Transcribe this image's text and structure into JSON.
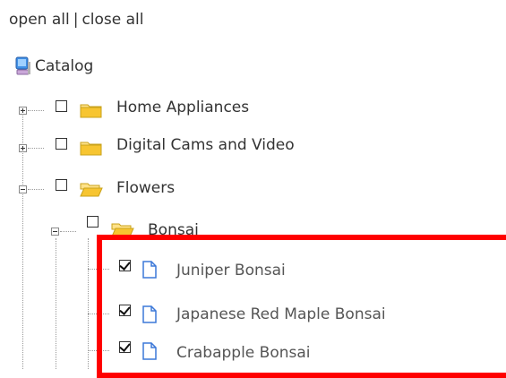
{
  "controls": {
    "open_all": "open all",
    "separator": "|",
    "close_all": "close all"
  },
  "tree": {
    "root": "Catalog",
    "items": [
      {
        "label": "Home Appliances"
      },
      {
        "label": "Digital Cams and Video"
      },
      {
        "label": "Flowers"
      },
      {
        "label": "Bonsai"
      },
      {
        "label": "Juniper Bonsai",
        "checked": true
      },
      {
        "label": "Japanese Red Maple Bonsai",
        "checked": true
      },
      {
        "label": "Crabapple Bonsai",
        "checked": true
      }
    ]
  },
  "colors": {
    "highlight": "#ff0000",
    "folder": "#f1c232",
    "leaf_icon": "#3c78d8"
  }
}
